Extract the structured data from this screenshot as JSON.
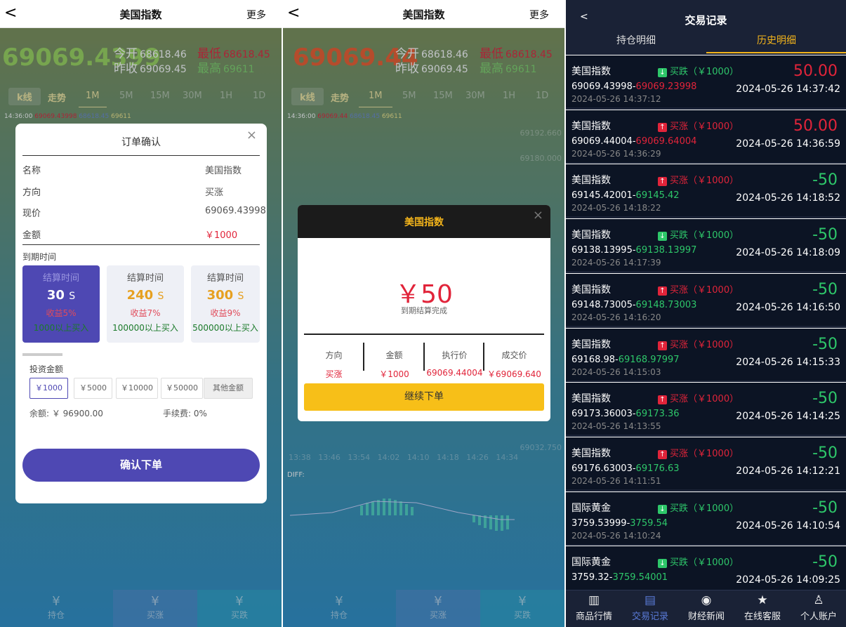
{
  "panel1": {
    "header": {
      "back": "<",
      "title": "美国指数",
      "more": "更多"
    },
    "price": "69069.4399",
    "quote": {
      "open_label": "今开",
      "open": "68618.46",
      "prev_label": "昨收",
      "prev": "69069.45",
      "low_label": "最低",
      "low": "68618.45",
      "high_label": "最高",
      "high": "69611"
    },
    "tabs": [
      "k线",
      "走势",
      "1M",
      "5M",
      "15M",
      "30M",
      "1H",
      "1D"
    ],
    "tick": {
      "time": "14:36:00",
      "a": "69069.43998",
      "b": "68618.45",
      "c": "69611"
    },
    "modal": {
      "title": "订单确认",
      "close": "×",
      "rows": [
        {
          "label": "名称",
          "value": "美国指数"
        },
        {
          "label": "方向",
          "value": "买涨"
        },
        {
          "label": "现价",
          "value": "69069.43998"
        },
        {
          "label": "金额",
          "value": "￥1000"
        }
      ],
      "expiry_label": "到期时间",
      "cards": [
        {
          "title": "结算时间",
          "value": "30",
          "unit": "S",
          "profit": "收益5%",
          "min": "1000以上买入"
        },
        {
          "title": "结算时间",
          "value": "240",
          "unit": "S",
          "profit": "收益7%",
          "min": "100000以上买入"
        },
        {
          "title": "结算时间",
          "value": "300",
          "unit": "S",
          "profit": "收益9%",
          "min": "500000以上买入"
        }
      ],
      "invest_label": "投资金额",
      "amounts": [
        "￥1000",
        "￥5000",
        "￥10000",
        "￥50000",
        "其他金额"
      ],
      "balance": "余额: ￥ 96900.00",
      "fee": "手续费: 0%",
      "confirm": "确认下单"
    },
    "nav": [
      {
        "icon": "¥",
        "label": "持仓"
      },
      {
        "icon": "¥",
        "label": "买涨"
      },
      {
        "icon": "¥",
        "label": "买跌"
      }
    ]
  },
  "panel2": {
    "header": {
      "back": "<",
      "title": "美国指数",
      "more": "更多"
    },
    "price": "69069.44",
    "quote": {
      "open_label": "今开",
      "open": "68618.46",
      "prev_label": "昨收",
      "prev": "69069.45",
      "low_label": "最低",
      "low": "68618.45",
      "high_label": "最高",
      "high": "69611"
    },
    "tabs": [
      "k线",
      "走势",
      "1M",
      "5M",
      "15M",
      "30M",
      "1H",
      "1D"
    ],
    "tick": {
      "time": "14:36:00",
      "a": "69069.44",
      "b": "68618.45",
      "c": "69611"
    },
    "axis_right": [
      "69192.660",
      "69180.000",
      "69032.750"
    ],
    "axis_bottom": [
      "13:38",
      "13:46",
      "13:54",
      "14:02",
      "14:10",
      "14:18",
      "14:26",
      "14:34"
    ],
    "diff_label": "DIFF:",
    "modal": {
      "title": "美国指数",
      "close": "×",
      "amount": "￥50",
      "status": "到期结算完成",
      "cols": [
        {
          "head": "方向",
          "val": "买涨"
        },
        {
          "head": "金额",
          "val": "￥1000"
        },
        {
          "head": "执行价",
          "val": "69069.44004"
        },
        {
          "head": "成交价",
          "val": "￥69069.640"
        }
      ],
      "button": "继续下单"
    },
    "nav": [
      {
        "icon": "¥",
        "label": "持仓"
      },
      {
        "icon": "¥",
        "label": "买涨"
      },
      {
        "icon": "¥",
        "label": "买跌"
      }
    ]
  },
  "panel3": {
    "header": {
      "back": "<",
      "title": "交易记录"
    },
    "tabs": [
      "持仓明细",
      "历史明细"
    ],
    "records": [
      {
        "name": "美国指数",
        "dir": "买跌（￥1000）",
        "up": false,
        "pl": "50.00",
        "win": true,
        "price_a": "69069.43998",
        "price_b": "69069.23998",
        "t1": "2024-05-26 14:37:12",
        "t2": "2024-05-26 14:37:42"
      },
      {
        "name": "美国指数",
        "dir": "买涨（￥1000）",
        "up": true,
        "pl": "50.00",
        "win": true,
        "price_a": "69069.44004",
        "price_b": "69069.64004",
        "t1": "2024-05-26 14:36:29",
        "t2": "2024-05-26 14:36:59"
      },
      {
        "name": "美国指数",
        "dir": "买涨（￥1000）",
        "up": true,
        "pl": "-50",
        "win": false,
        "price_a": "69145.42001",
        "price_b": "69145.42",
        "t1": "2024-05-26 14:18:22",
        "t2": "2024-05-26 14:18:52"
      },
      {
        "name": "美国指数",
        "dir": "买跌（￥1000）",
        "up": false,
        "pl": "-50",
        "win": false,
        "price_a": "69138.13995",
        "price_b": "69138.13997",
        "t1": "2024-05-26 14:17:39",
        "t2": "2024-05-26 14:18:09"
      },
      {
        "name": "美国指数",
        "dir": "买涨（￥1000）",
        "up": true,
        "pl": "-50",
        "win": false,
        "price_a": "69148.73005",
        "price_b": "69148.73003",
        "t1": "2024-05-26 14:16:20",
        "t2": "2024-05-26 14:16:50"
      },
      {
        "name": "美国指数",
        "dir": "买涨（￥1000）",
        "up": true,
        "pl": "-50",
        "win": false,
        "price_a": "69168.98",
        "price_b": "69168.97997",
        "t1": "2024-05-26 14:15:03",
        "t2": "2024-05-26 14:15:33"
      },
      {
        "name": "美国指数",
        "dir": "买涨（￥1000）",
        "up": true,
        "pl": "-50",
        "win": false,
        "price_a": "69173.36003",
        "price_b": "69173.36",
        "t1": "2024-05-26 14:13:55",
        "t2": "2024-05-26 14:14:25"
      },
      {
        "name": "美国指数",
        "dir": "买涨（￥1000）",
        "up": true,
        "pl": "-50",
        "win": false,
        "price_a": "69176.63003",
        "price_b": "69176.63",
        "t1": "2024-05-26 14:11:51",
        "t2": "2024-05-26 14:12:21"
      },
      {
        "name": "国际黄金",
        "dir": "买跌（￥1000）",
        "up": false,
        "pl": "-50",
        "win": false,
        "price_a": "3759.53999",
        "price_b": "3759.54",
        "t1": "2024-05-26 14:10:24",
        "t2": "2024-05-26 14:10:54"
      },
      {
        "name": "国际黄金",
        "dir": "买跌（￥1000）",
        "up": false,
        "pl": "-50",
        "win": false,
        "price_a": "3759.32",
        "price_b": "3759.54001",
        "t1": "",
        "t2": "2024-05-26 14:09:25"
      }
    ],
    "nav": [
      {
        "icon": "▥",
        "label": "商品行情"
      },
      {
        "icon": "▤",
        "label": "交易记录"
      },
      {
        "icon": "◉",
        "label": "财经新闻"
      },
      {
        "icon": "★",
        "label": "在线客服"
      },
      {
        "icon": "♙",
        "label": "个人账户"
      }
    ]
  },
  "colors": {
    "red": "#e1243a",
    "green": "#2ec76a",
    "gold": "#f3b41b",
    "purple": "#4e48b3"
  }
}
